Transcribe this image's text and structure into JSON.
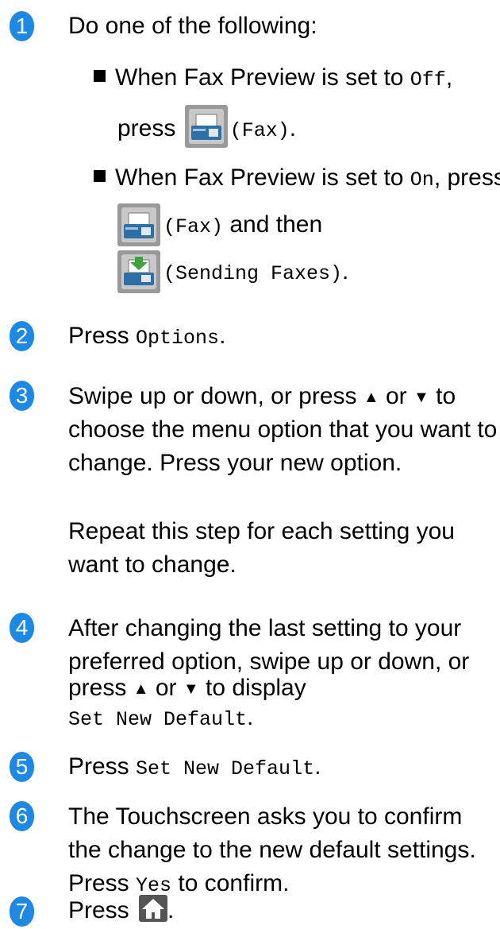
{
  "steps": [
    {
      "num": "1",
      "intro": "Do one of the following:",
      "bullet1": {
        "pre": "When Fax Preview is set to ",
        "code": "Off",
        "post": ",",
        "press": "press ",
        "btn": "(Fax)",
        "end": "."
      },
      "bullet2": {
        "pre": "When Fax Preview is set to ",
        "code": "On",
        "post": ", press",
        "btn1": "(Fax)",
        "mid": " and then",
        "btn2": "(Sending Faxes)",
        "end": "."
      }
    },
    {
      "num": "2",
      "pre": "Press ",
      "code": "Options",
      "end": "."
    },
    {
      "num": "3",
      "l1_pre": "Swipe up or down, or press ",
      "up": "▲",
      "or": " or ",
      "down": "▼",
      "l1_post": " to",
      "l2": "choose the menu option that you want to",
      "l3": "change. Press your new option.",
      "l4": "Repeat this step for each setting you",
      "l5": "want to change."
    },
    {
      "num": "4",
      "l1": "After changing the last setting to your",
      "l2": "preferred option, swipe up or down, or",
      "l3_pre": "press ",
      "up": "▲",
      "or": " or ",
      "down": "▼",
      "l3_post": " to display",
      "code": "Set New Default",
      "end": "."
    },
    {
      "num": "5",
      "pre": "Press ",
      "code": "Set New Default",
      "end": "."
    },
    {
      "num": "6",
      "l1": "The Touchscreen asks you to confirm",
      "l2": "the change to the new default settings.",
      "l3_pre": "Press ",
      "code": "Yes",
      "l3_post": " to confirm."
    },
    {
      "num": "7",
      "pre": "Press ",
      "end": "."
    }
  ],
  "icons": {
    "fax": "fax-icon",
    "sending_faxes": "sending-faxes-icon",
    "home": "home-icon"
  },
  "colors": {
    "badge": "#1e88e5",
    "icon_bg": "#999999"
  }
}
